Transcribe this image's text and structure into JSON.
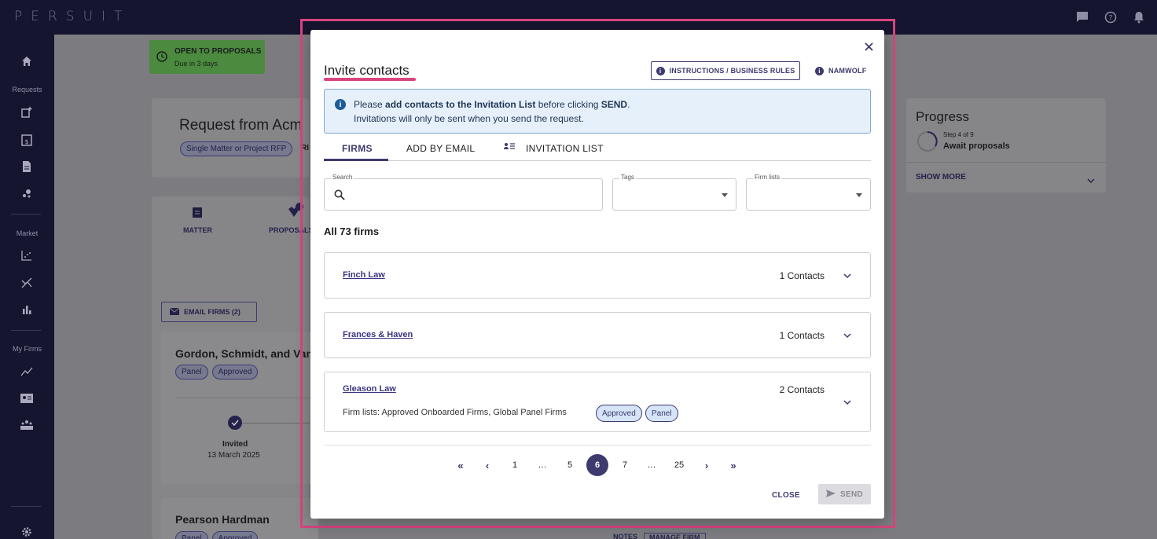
{
  "app": {
    "logo": "PERSUIT"
  },
  "sidebar": {
    "sections": [
      "Requests",
      "Market",
      "My Firms"
    ]
  },
  "background": {
    "status_title": "OPEN TO PROPOSALS",
    "status_sub": "Due in 3 days",
    "request_title": "Request from Acm",
    "request_chip": "Single Matter or Project RFP",
    "request_chip2": "RI",
    "tab_matter": "MATTER",
    "tab_proposals": "PROPOSALS",
    "email_firms": "EMAIL FIRMS (2)",
    "firm1_name": "Gordon, Schmidt, and Van",
    "firm1_chip1": "Panel",
    "firm1_chip2": "Approved",
    "firm1_status": "Invited",
    "firm1_date": "13 March 2025",
    "firm2_name": "Pearson Hardman",
    "firm2_chip1": "Panel",
    "firm2_chip2": "Approved",
    "notes": "NOTES",
    "manage_firm": "MANAGE FIRM",
    "progress_title": "Progress",
    "progress_step": "Step 4 of 9",
    "progress_label": "Await proposals",
    "show_more": "SHOW MORE"
  },
  "modal": {
    "title": "Invite contacts",
    "instructions_button": "INSTRUCTIONS / BUSINESS RULES",
    "namwolf_button": "NAMWOLF",
    "alert_line1_pre": "Please ",
    "alert_line1_bold": "add contacts to the Invitation List",
    "alert_line1_mid": " before clicking ",
    "alert_line1_bold2": "SEND",
    "alert_line1_end": ".",
    "alert_line2": "Invitations will only be sent when you send the request.",
    "tabs": [
      {
        "label": "FIRMS"
      },
      {
        "label": "ADD BY EMAIL"
      },
      {
        "label": "INVITATION LIST"
      }
    ],
    "search_label": "Search",
    "tags_label": "Tags",
    "firm_lists_label": "Firm lists",
    "all_firms": "All 73 firms",
    "firms": [
      {
        "name": "Finch Law",
        "contacts": "1 Contacts"
      },
      {
        "name": "Frances & Haven",
        "contacts": "1 Contacts"
      },
      {
        "name": "Gleason Law",
        "contacts": "2 Contacts",
        "lists": "Firm lists:  Approved Onboarded Firms,  Global Panel Firms",
        "tags": [
          "Approved",
          "Panel"
        ]
      }
    ],
    "pagination": {
      "pages": [
        "1",
        "…",
        "5",
        "6",
        "7",
        "…",
        "25"
      ],
      "current": "6"
    },
    "close_button": "CLOSE",
    "send_button": "SEND"
  },
  "colors": {
    "accent": "#3d3a6e",
    "highlight": "#d8457e",
    "alert_bg": "#e6f0fb"
  }
}
